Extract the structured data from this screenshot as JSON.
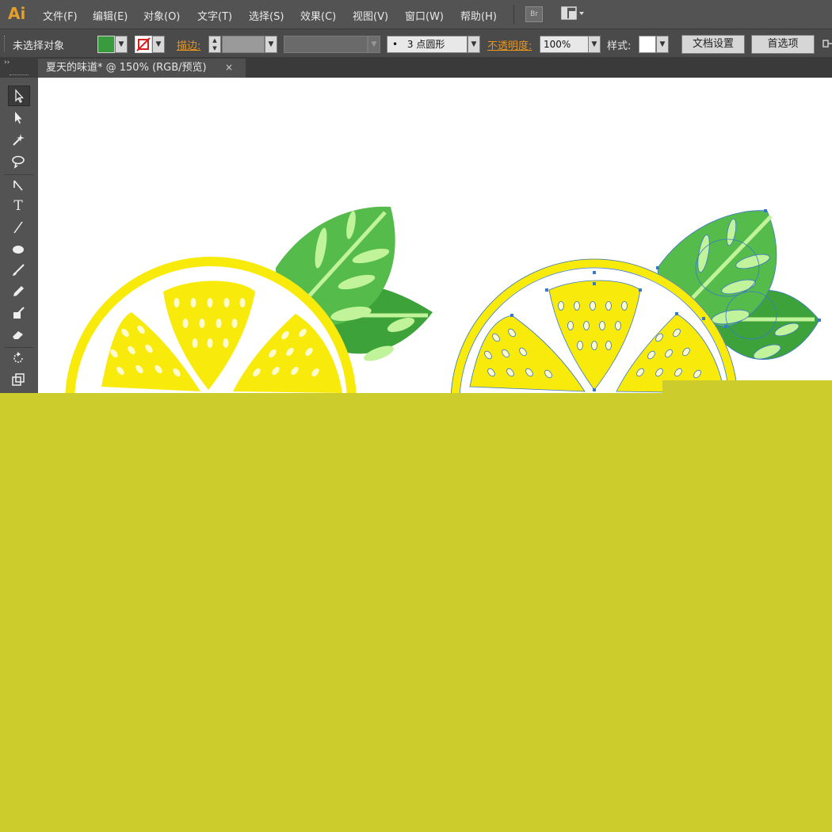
{
  "app": {
    "logo": "Ai"
  },
  "menu": [
    "文件(F)",
    "编辑(E)",
    "对象(O)",
    "文字(T)",
    "选择(S)",
    "效果(C)",
    "视图(V)",
    "窗口(W)",
    "帮助(H)"
  ],
  "menu_icons": {
    "bridge": "Br"
  },
  "control": {
    "selection_status": "未选择对象",
    "fill_color": "#3a9a3e",
    "stroke_label": "描边:",
    "brush": "3 点圆形",
    "opacity_label": "不透明度:",
    "opacity_value": "100%",
    "style_label": "样式:",
    "doc_setup": "文档设置",
    "preferences": "首选项"
  },
  "document": {
    "tab_title": "夏天的味道* @ 150% (RGB/预览)",
    "close_glyph": "×"
  },
  "colors": {
    "lemon_yellow": "#f8ea0a",
    "leaf_dark": "#3ea23b",
    "leaf_mid": "#55bb4b",
    "leaf_light": "#c1f39a",
    "selection_blue": "#3a78c8",
    "overlay": "#cccd2c"
  }
}
